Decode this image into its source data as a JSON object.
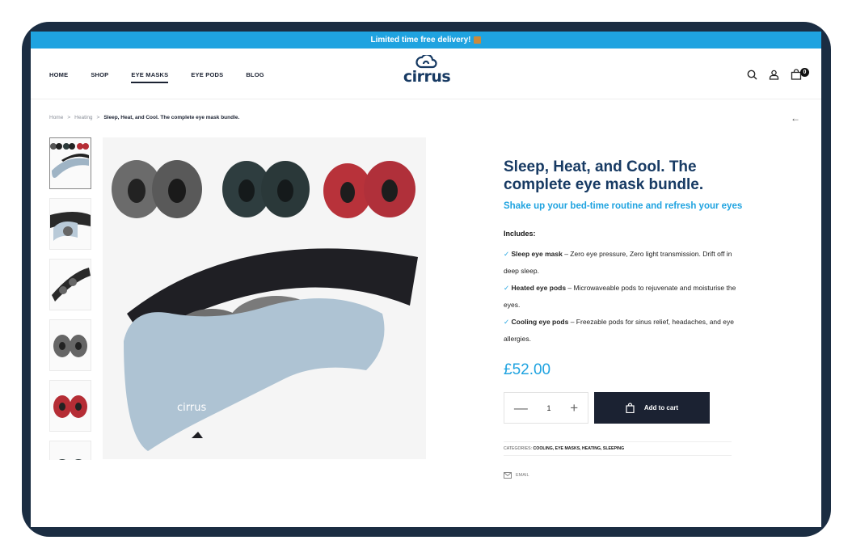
{
  "promo": {
    "text": "Limited time free delivery!",
    "icon": "box-icon"
  },
  "nav": {
    "items": [
      "HOME",
      "SHOP",
      "EYE MASKS",
      "EYE PODS",
      "BLOG"
    ],
    "active_index": 2
  },
  "logo": {
    "text": "cirrus",
    "icon": "cloud-icon"
  },
  "header_icons": {
    "search": "search-icon",
    "account": "user-icon",
    "cart": "cart-icon",
    "cart_count": "0"
  },
  "breadcrumb": {
    "items": [
      "Home",
      "Heating",
      "Sleep, Heat, and Cool. The complete eye mask bundle."
    ],
    "separator": ">"
  },
  "back_arrow": "←",
  "product": {
    "title": "Sleep, Heat, and Cool. The complete eye mask bundle.",
    "subtitle": "Shake up your bed-time routine and refresh your eyes",
    "includes_label": "Includes:",
    "features": [
      {
        "check": "✓",
        "name": "Sleep eye mask",
        "text": " – Zero eye pressure, Zero light transmission. Drift off in deep sleep."
      },
      {
        "check": "✓",
        "name": "Heated eye pods",
        "text": " – Microwaveable pods to rejuvenate and moisturise the eyes."
      },
      {
        "check": "✓",
        "name": "Cooling eye pods",
        "text": " – Freezable pods for sinus relief, headaches, and eye allergies."
      }
    ],
    "price": "£52.00",
    "quantity": "1",
    "minus": "—",
    "plus": "+",
    "add_to_cart": "Add to cart",
    "categories_label": "CATEGORIES:",
    "categories": "COOLING, EYE MASKS, HEATING, SLEEPING",
    "email_label": "EMAIL",
    "image_text": "cirrus"
  },
  "colors": {
    "accent": "#1fa3e0",
    "navy": "#173a63",
    "frame": "#1b2d42",
    "button": "#1b2232"
  }
}
